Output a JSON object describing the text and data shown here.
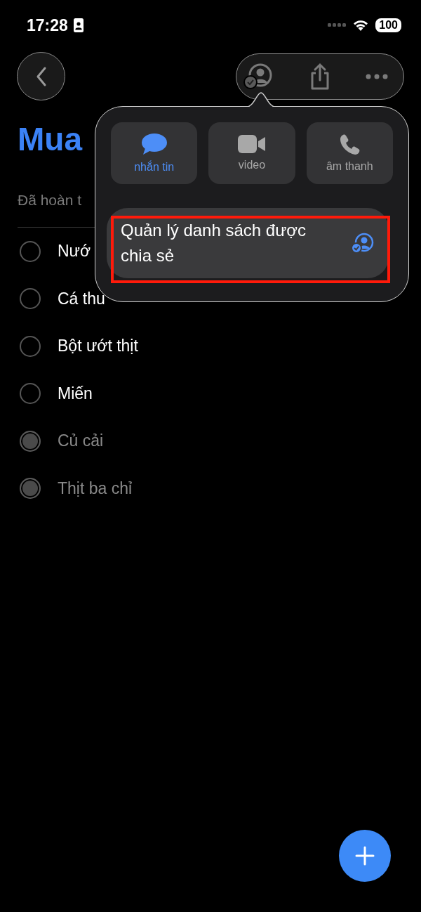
{
  "status_bar": {
    "time": "17:28",
    "battery": "100"
  },
  "list": {
    "title": "Mua",
    "subtitle": "Đã hoàn t"
  },
  "items": [
    {
      "text": "Nướ",
      "checked": false
    },
    {
      "text": "Cá thu",
      "checked": false
    },
    {
      "text": "Bột ướt thịt",
      "checked": false
    },
    {
      "text": "Miến",
      "checked": false
    },
    {
      "text": "Củ  cải",
      "checked": true
    },
    {
      "text": "Thịt ba chỉ",
      "checked": true
    }
  ],
  "popover": {
    "actions": [
      {
        "kind": "message",
        "label": "nhắn tin",
        "selected": true
      },
      {
        "kind": "video",
        "label": "video",
        "selected": false
      },
      {
        "kind": "audio",
        "label": "âm thanh",
        "selected": false
      }
    ],
    "menu_item": {
      "label": "Quản lý danh sách được chia sẻ",
      "highlighted": true
    }
  }
}
